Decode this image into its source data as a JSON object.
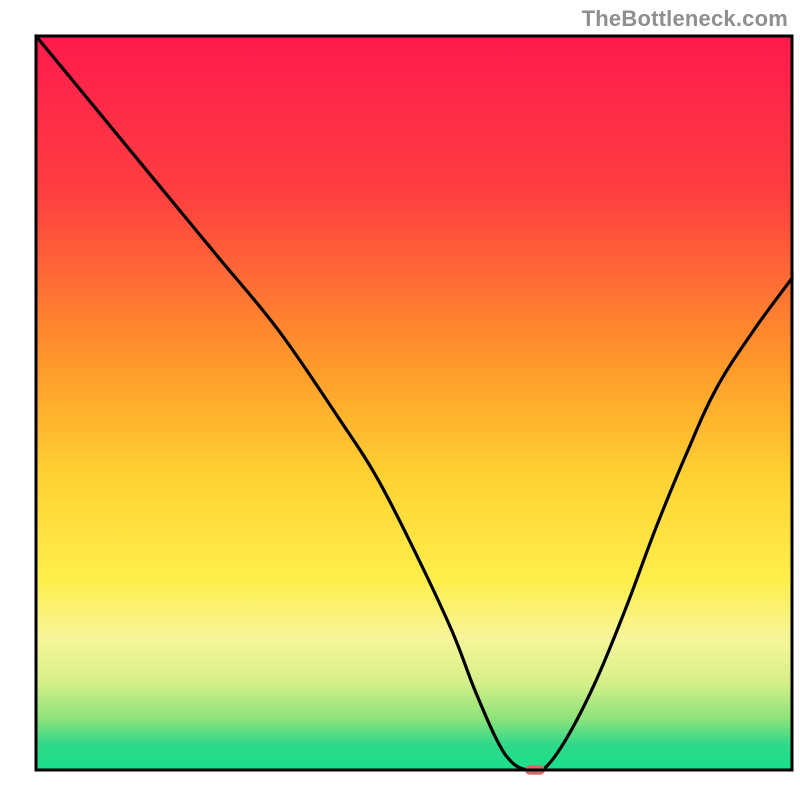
{
  "attribution": "TheBottleneck.com",
  "chart_data": {
    "type": "line",
    "title": "",
    "xlabel": "",
    "ylabel": "",
    "xlim": [
      0,
      100
    ],
    "ylim": [
      0,
      100
    ],
    "background_gradient": {
      "orientation": "vertical",
      "stops": [
        {
          "offset": 0.0,
          "color": "#ff1a4d"
        },
        {
          "offset": 0.22,
          "color": "#ff4040"
        },
        {
          "offset": 0.45,
          "color": "#ff9a2a"
        },
        {
          "offset": 0.6,
          "color": "#ffd233"
        },
        {
          "offset": 0.74,
          "color": "#ffef4a"
        },
        {
          "offset": 0.82,
          "color": "#f7f59a"
        },
        {
          "offset": 0.88,
          "color": "#d6f089"
        },
        {
          "offset": 0.93,
          "color": "#8de27a"
        },
        {
          "offset": 0.965,
          "color": "#2fd98b"
        },
        {
          "offset": 1.0,
          "color": "#17e08a"
        }
      ]
    },
    "series": [
      {
        "name": "bottleneck-curve",
        "color": "#000000",
        "x": [
          0,
          8,
          16,
          24,
          32,
          40,
          45,
          50,
          55,
          58,
          61,
          63,
          65,
          67,
          70,
          74,
          78,
          82,
          86,
          90,
          95,
          100
        ],
        "y": [
          100,
          90,
          80,
          70,
          60,
          48,
          40,
          30,
          19,
          11,
          4,
          1,
          0,
          0,
          4,
          12,
          22,
          33,
          43,
          52,
          60,
          67
        ]
      }
    ],
    "marker": {
      "name": "optimal-pill",
      "x": 66.0,
      "y": 0.0,
      "color": "#d46a6a",
      "width_pct": 2.6,
      "height_pct": 1.3
    },
    "axes_box": {
      "color": "#000000",
      "stroke_width": 3
    }
  }
}
